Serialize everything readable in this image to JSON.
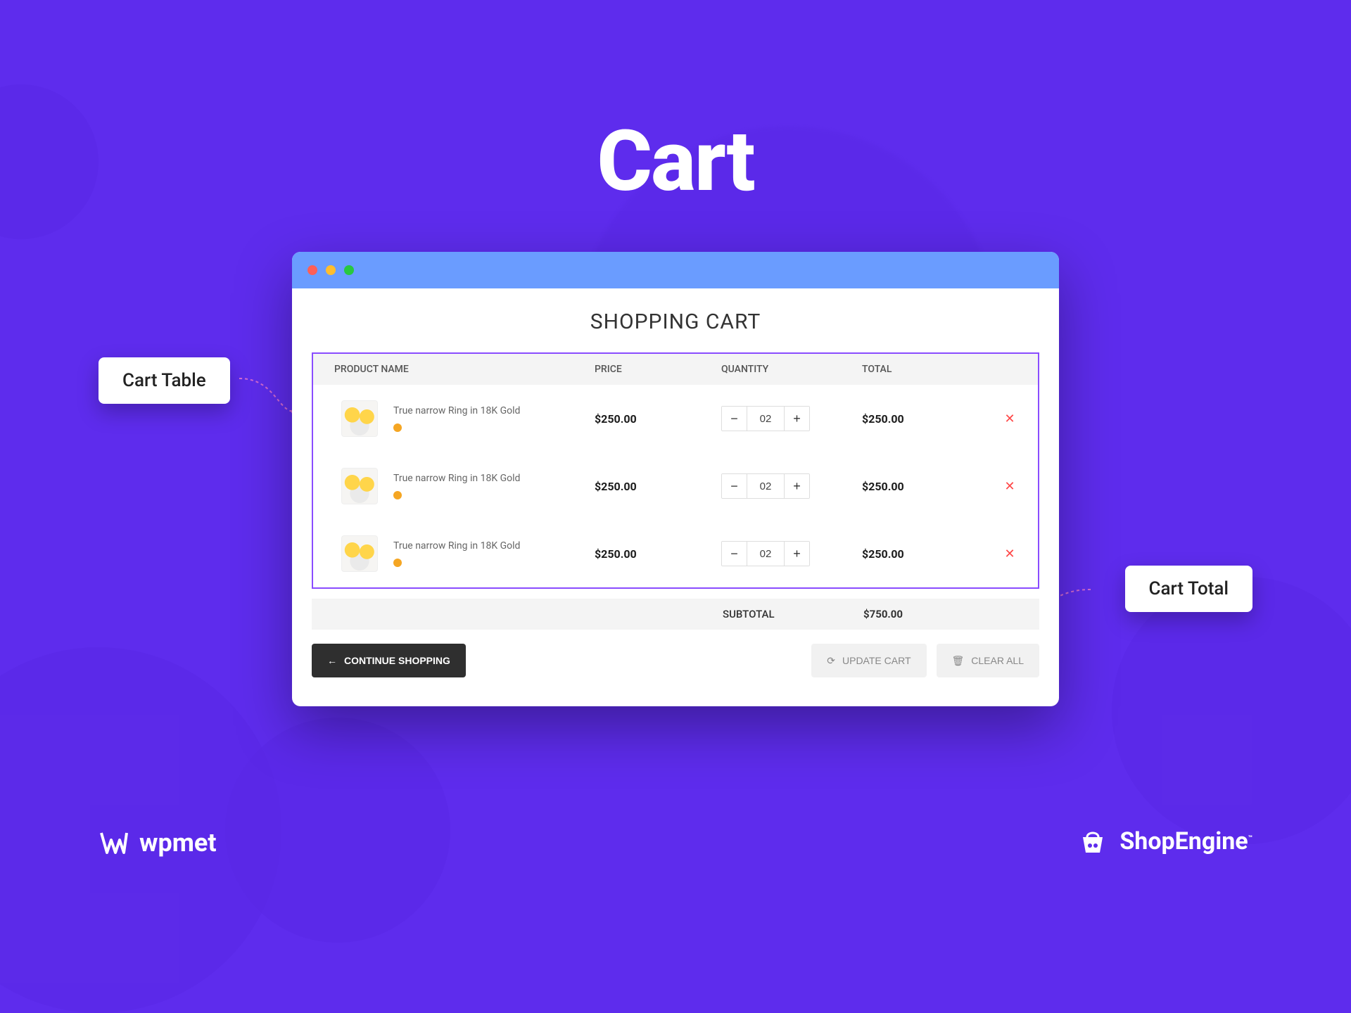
{
  "hero": {
    "title": "Cart"
  },
  "page": {
    "title": "SHOPPING CART"
  },
  "headers": {
    "product": "PRODUCT NAME",
    "price": "PRICE",
    "qty": "QUANTITY",
    "total": "TOTAL"
  },
  "rows": [
    {
      "name": "True narrow Ring in 18K Gold",
      "price": "$250.00",
      "qty": "02",
      "total": "$250.00"
    },
    {
      "name": "True narrow Ring in 18K Gold",
      "price": "$250.00",
      "qty": "02",
      "total": "$250.00"
    },
    {
      "name": "True narrow Ring in 18K Gold",
      "price": "$250.00",
      "qty": "02",
      "total": "$250.00"
    }
  ],
  "subtotal": {
    "label": "SUBTOTAL",
    "value": "$750.00"
  },
  "actions": {
    "continue": "CONTINUE SHOPPING",
    "update": "UPDATE CART",
    "clear": "CLEAR ALL"
  },
  "callouts": {
    "table": "Cart Table",
    "total": "Cart Total"
  },
  "brands": {
    "left": "wpmet",
    "right": "ShopEngine"
  }
}
